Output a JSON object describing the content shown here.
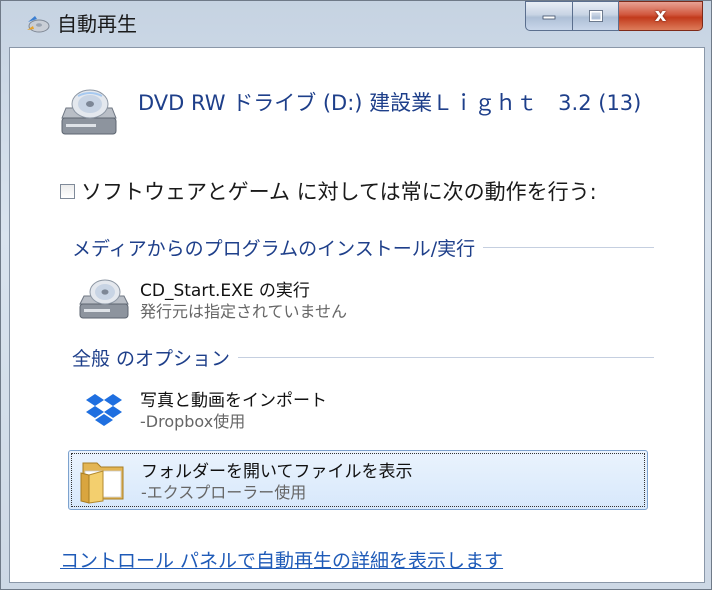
{
  "window": {
    "title": "自動再生",
    "buttons": {
      "close_glyph": "x"
    }
  },
  "drive": {
    "title": "DVD RW ドライブ (D:) 建設業Ｌｉｇｈｔ　3.2 (13)",
    "icon": "dvd-drive-icon"
  },
  "checkbox": {
    "label": "ソフトウェアとゲーム に対しては常に次の動作を行う:",
    "checked": false
  },
  "sections": [
    {
      "title": "メディアからのプログラムのインストール/実行",
      "options": [
        {
          "title": "CD_Start.EXE の実行",
          "subtitle": "発行元は指定されていません",
          "icon": "dvd-drive-icon"
        }
      ]
    },
    {
      "title": "全般 のオプション",
      "options": [
        {
          "title": "写真と動画をインポート",
          "subtitle": "-Dropbox使用",
          "icon": "dropbox-icon"
        },
        {
          "title": "フォルダーを開いてファイルを表示",
          "subtitle": "-エクスプローラー使用",
          "icon": "folder-icon",
          "selected": true
        }
      ]
    }
  ],
  "control_panel_link": "コントロール パネルで自動再生の詳細を表示します",
  "colors": {
    "link": "#1f5bb8",
    "heading": "#1e3f8a",
    "selection": "#d7e8fb"
  }
}
